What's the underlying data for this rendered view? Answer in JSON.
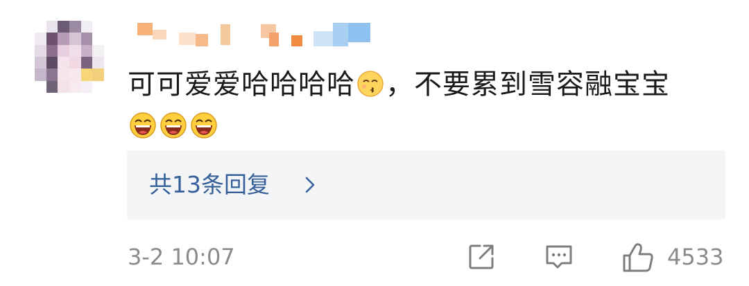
{
  "comment": {
    "text_part1": "可可爱爱哈哈哈哈",
    "text_part2": "，不要累到雪容融宝宝",
    "inline_emoji": "kiss-smile-emoji",
    "trailing_emojis": [
      "laugh-emoji",
      "laugh-emoji",
      "laugh-emoji"
    ]
  },
  "replies": {
    "label": "共13条回复",
    "chevron_icon": "chevron-right-icon"
  },
  "footer": {
    "timestamp": "3-2 10:07",
    "share_icon": "share-icon",
    "reply_icon": "comment-icon",
    "like_icon": "thumbs-up-icon",
    "like_count": "4533"
  },
  "colors": {
    "reply_link": "#36609a",
    "muted": "#8a8a8a",
    "reply_box_bg": "#f4f5f7"
  }
}
